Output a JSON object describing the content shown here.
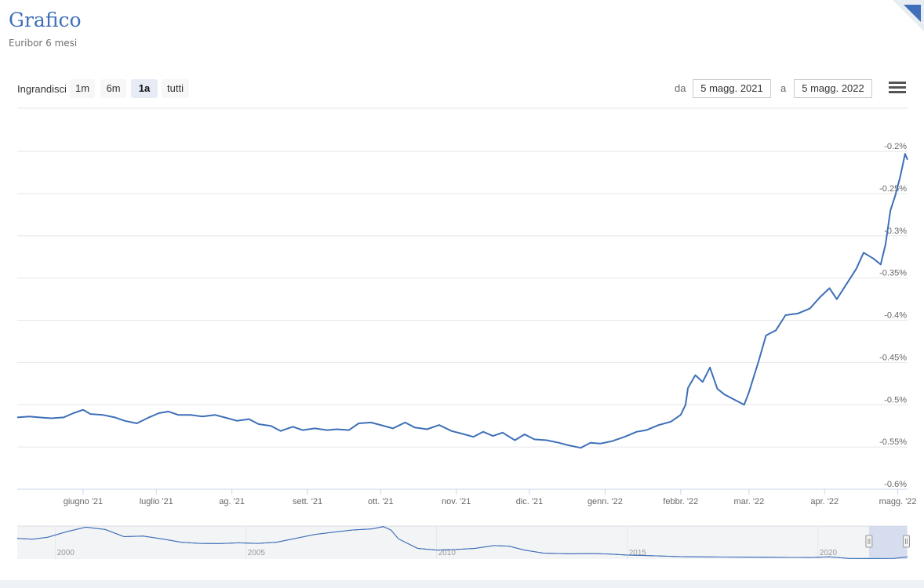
{
  "header": {
    "title": "Grafico",
    "subtitle": "Euribor 6 mesi"
  },
  "toolbar": {
    "zoom_label": "Ingrandisci",
    "zoom_buttons": [
      "1m",
      "6m",
      "1a",
      "tutti"
    ],
    "active_zoom": "1a",
    "from_label": "da",
    "from_value": "5 magg. 2021",
    "to_label": "a",
    "to_value": "5 magg. 2022",
    "menu_icon": "hamburger-menu-icon"
  },
  "colors": {
    "line": "#3e6fb8",
    "grid": "#e6e6e6",
    "navigator_mask": "#cdd7ee"
  },
  "chart_data": {
    "type": "line",
    "title": "",
    "xlabel": "",
    "ylabel": "",
    "grid": true,
    "ylim": [
      -0.6,
      -0.2
    ],
    "y_ticks": [
      "-0.2%",
      "-0.25%",
      "-0.3%",
      "-0.35%",
      "-0.4%",
      "-0.45%",
      "-0.5%",
      "-0.55%",
      "-0.6%"
    ],
    "x_range": [
      "2021-05-05",
      "2022-05-05"
    ],
    "x_ticks": [
      {
        "label": "giugno '21",
        "date": "2021-06-01"
      },
      {
        "label": "luglio '21",
        "date": "2021-07-01"
      },
      {
        "label": "ag. '21",
        "date": "2021-08-01"
      },
      {
        "label": "sett. '21",
        "date": "2021-09-01"
      },
      {
        "label": "ott. '21",
        "date": "2021-10-01"
      },
      {
        "label": "nov. '21",
        "date": "2021-11-01"
      },
      {
        "label": "dic. '21",
        "date": "2021-12-01"
      },
      {
        "label": "genn. '22",
        "date": "2022-01-01"
      },
      {
        "label": "febbr. '22",
        "date": "2022-02-01"
      },
      {
        "label": "mar. '22",
        "date": "2022-03-01"
      },
      {
        "label": "apr. '22",
        "date": "2022-04-01"
      },
      {
        "label": "magg. '22",
        "date": "2022-05-01"
      }
    ],
    "series": [
      {
        "points": [
          [
            "2021-05-05",
            -0.515
          ],
          [
            "2021-05-10",
            -0.514
          ],
          [
            "2021-05-14",
            -0.515
          ],
          [
            "2021-05-19",
            -0.516
          ],
          [
            "2021-05-24",
            -0.515
          ],
          [
            "2021-05-28",
            -0.51
          ],
          [
            "2021-06-01",
            -0.506
          ],
          [
            "2021-06-04",
            -0.511
          ],
          [
            "2021-06-09",
            -0.512
          ],
          [
            "2021-06-14",
            -0.515
          ],
          [
            "2021-06-18",
            -0.519
          ],
          [
            "2021-06-23",
            -0.522
          ],
          [
            "2021-06-28",
            -0.515
          ],
          [
            "2021-07-02",
            -0.51
          ],
          [
            "2021-07-06",
            -0.508
          ],
          [
            "2021-07-10",
            -0.512
          ],
          [
            "2021-07-15",
            -0.512
          ],
          [
            "2021-07-20",
            -0.514
          ],
          [
            "2021-07-25",
            -0.512
          ],
          [
            "2021-07-29",
            -0.515
          ],
          [
            "2021-08-03",
            -0.519
          ],
          [
            "2021-08-08",
            -0.517
          ],
          [
            "2021-08-12",
            -0.523
          ],
          [
            "2021-08-17",
            -0.525
          ],
          [
            "2021-08-21",
            -0.531
          ],
          [
            "2021-08-26",
            -0.526
          ],
          [
            "2021-08-30",
            -0.53
          ],
          [
            "2021-09-04",
            -0.528
          ],
          [
            "2021-09-09",
            -0.53
          ],
          [
            "2021-09-13",
            -0.529
          ],
          [
            "2021-09-18",
            -0.53
          ],
          [
            "2021-09-22",
            -0.522
          ],
          [
            "2021-09-27",
            -0.521
          ],
          [
            "2021-10-01",
            -0.524
          ],
          [
            "2021-10-06",
            -0.528
          ],
          [
            "2021-10-11",
            -0.521
          ],
          [
            "2021-10-15",
            -0.527
          ],
          [
            "2021-10-20",
            -0.529
          ],
          [
            "2021-10-25",
            -0.524
          ],
          [
            "2021-10-30",
            -0.531
          ],
          [
            "2021-11-03",
            -0.534
          ],
          [
            "2021-11-08",
            -0.538
          ],
          [
            "2021-11-12",
            -0.532
          ],
          [
            "2021-11-16",
            -0.537
          ],
          [
            "2021-11-20",
            -0.533
          ],
          [
            "2021-11-25",
            -0.542
          ],
          [
            "2021-11-29",
            -0.535
          ],
          [
            "2021-12-03",
            -0.541
          ],
          [
            "2021-12-08",
            -0.542
          ],
          [
            "2021-12-13",
            -0.545
          ],
          [
            "2021-12-17",
            -0.548
          ],
          [
            "2021-12-22",
            -0.551
          ],
          [
            "2021-12-26",
            -0.545
          ],
          [
            "2021-12-30",
            -0.546
          ],
          [
            "2022-01-04",
            -0.543
          ],
          [
            "2022-01-09",
            -0.538
          ],
          [
            "2022-01-14",
            -0.532
          ],
          [
            "2022-01-18",
            -0.53
          ],
          [
            "2022-01-23",
            -0.524
          ],
          [
            "2022-01-28",
            -0.52
          ],
          [
            "2022-02-01",
            -0.512
          ],
          [
            "2022-02-03",
            -0.5
          ],
          [
            "2022-02-04",
            -0.48
          ],
          [
            "2022-02-07",
            -0.465
          ],
          [
            "2022-02-10",
            -0.473
          ],
          [
            "2022-02-13",
            -0.456
          ],
          [
            "2022-02-16",
            -0.481
          ],
          [
            "2022-02-19",
            -0.488
          ],
          [
            "2022-02-23",
            -0.494
          ],
          [
            "2022-02-27",
            -0.5
          ],
          [
            "2022-03-01",
            -0.485
          ],
          [
            "2022-03-05",
            -0.448
          ],
          [
            "2022-03-08",
            -0.418
          ],
          [
            "2022-03-12",
            -0.412
          ],
          [
            "2022-03-16",
            -0.394
          ],
          [
            "2022-03-21",
            -0.392
          ],
          [
            "2022-03-26",
            -0.386
          ],
          [
            "2022-03-30",
            -0.373
          ],
          [
            "2022-04-03",
            -0.362
          ],
          [
            "2022-04-06",
            -0.375
          ],
          [
            "2022-04-10",
            -0.357
          ],
          [
            "2022-04-14",
            -0.339
          ],
          [
            "2022-04-17",
            -0.32
          ],
          [
            "2022-04-21",
            -0.327
          ],
          [
            "2022-04-24",
            -0.334
          ],
          [
            "2022-04-26",
            -0.31
          ],
          [
            "2022-04-28",
            -0.27
          ],
          [
            "2022-04-30",
            -0.252
          ],
          [
            "2022-05-02",
            -0.23
          ],
          [
            "2022-05-04",
            -0.203
          ],
          [
            "2022-05-05",
            -0.21
          ]
        ]
      }
    ],
    "navigator": {
      "x_ticks": [
        {
          "label": "2000",
          "year": 2000
        },
        {
          "label": "2005",
          "year": 2005
        },
        {
          "label": "2010",
          "year": 2010
        },
        {
          "label": "2015",
          "year": 2015
        },
        {
          "label": "2020",
          "year": 2020
        }
      ],
      "x_range": [
        1999,
        2022.35
      ],
      "ylim": [
        -0.6,
        5.3
      ],
      "points": [
        [
          1999.0,
          3.1
        ],
        [
          1999.4,
          2.95
        ],
        [
          1999.8,
          3.3
        ],
        [
          2000.3,
          4.3
        ],
        [
          2000.8,
          5.1
        ],
        [
          2001.3,
          4.7
        ],
        [
          2001.8,
          3.4
        ],
        [
          2002.3,
          3.5
        ],
        [
          2002.8,
          3.0
        ],
        [
          2003.3,
          2.4
        ],
        [
          2003.8,
          2.2
        ],
        [
          2004.3,
          2.15
        ],
        [
          2004.8,
          2.3
        ],
        [
          2005.3,
          2.2
        ],
        [
          2005.8,
          2.4
        ],
        [
          2006.3,
          3.1
        ],
        [
          2006.8,
          3.8
        ],
        [
          2007.3,
          4.2
        ],
        [
          2007.8,
          4.6
        ],
        [
          2008.3,
          4.8
        ],
        [
          2008.6,
          5.2
        ],
        [
          2008.8,
          4.6
        ],
        [
          2009.0,
          3.0
        ],
        [
          2009.5,
          1.3
        ],
        [
          2010.0,
          1.0
        ],
        [
          2010.5,
          1.1
        ],
        [
          2011.0,
          1.3
        ],
        [
          2011.5,
          1.8
        ],
        [
          2011.9,
          1.7
        ],
        [
          2012.3,
          1.0
        ],
        [
          2012.8,
          0.45
        ],
        [
          2013.5,
          0.33
        ],
        [
          2014.0,
          0.38
        ],
        [
          2014.5,
          0.3
        ],
        [
          2015.0,
          0.1
        ],
        [
          2015.5,
          0.02
        ],
        [
          2016.0,
          -0.1
        ],
        [
          2016.5,
          -0.19
        ],
        [
          2017.5,
          -0.25
        ],
        [
          2018.5,
          -0.27
        ],
        [
          2019.3,
          -0.32
        ],
        [
          2019.8,
          -0.34
        ],
        [
          2020.3,
          -0.2
        ],
        [
          2020.8,
          -0.5
        ],
        [
          2021.5,
          -0.52
        ],
        [
          2022.0,
          -0.5
        ],
        [
          2022.35,
          -0.2
        ]
      ],
      "selection": [
        "2021-05-05",
        "2022-05-05"
      ]
    }
  }
}
